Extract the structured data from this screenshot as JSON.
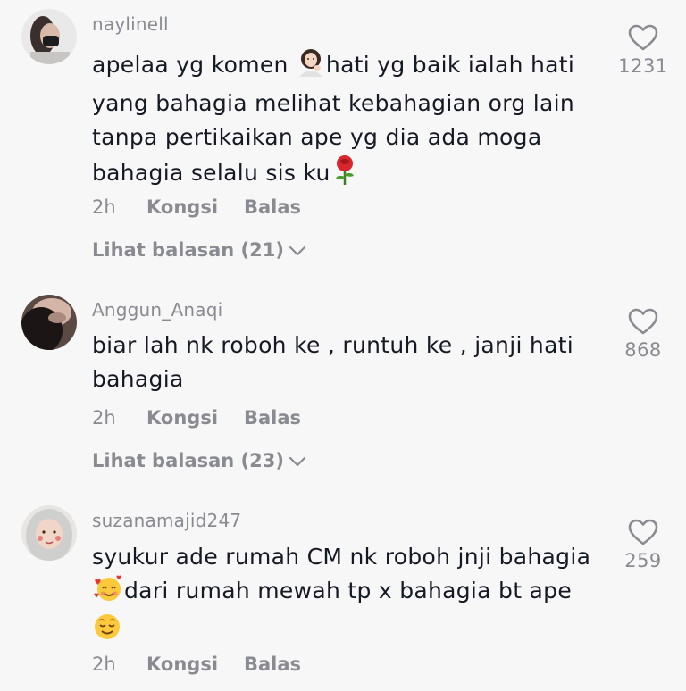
{
  "comments": [
    {
      "username": "naylinell",
      "text_parts": [
        "apelaa yg komen ",
        "hati yg baik ialah hati yang bahagia melihat kebahagian org lain tanpa pertikaikan ape yg dia ada moga bahagia selalu sis ku"
      ],
      "emojis": [
        "woman-tipping-hand-emoji",
        "rose-emoji"
      ],
      "time": "2h",
      "share_label": "Kongsi",
      "reply_label": "Balas",
      "view_replies": "Lihat balasan (21)",
      "likes": "1231",
      "avatar": "user-avatar-photo"
    },
    {
      "username": "Anggun_Anaqi",
      "text_parts": [
        "biar lah nk roboh ke , runtuh ke , janji hati bahagia"
      ],
      "time": "2h",
      "share_label": "Kongsi",
      "reply_label": "Balas",
      "view_replies": "Lihat balasan (23)",
      "likes": "868",
      "avatar": "user-avatar-photo"
    },
    {
      "username": "suzanamajid247",
      "text_parts": [
        "syukur ade rumah CM nk roboh jnji bahagia ",
        "dari rumah mewah tp x bahagia bt ape "
      ],
      "emojis": [
        "smiling-face-with-hearts-emoji",
        "relieved-face-emoji"
      ],
      "time": "2h",
      "share_label": "Kongsi",
      "reply_label": "Balas",
      "likes": "259",
      "avatar": "user-avatar-photo"
    }
  ],
  "icons": {
    "like": "heart-outline-icon",
    "expand": "chevron-down-icon"
  },
  "colors": {
    "background": "#f7f7f8",
    "text_primary": "#161823",
    "text_secondary": "#8a8b91"
  }
}
